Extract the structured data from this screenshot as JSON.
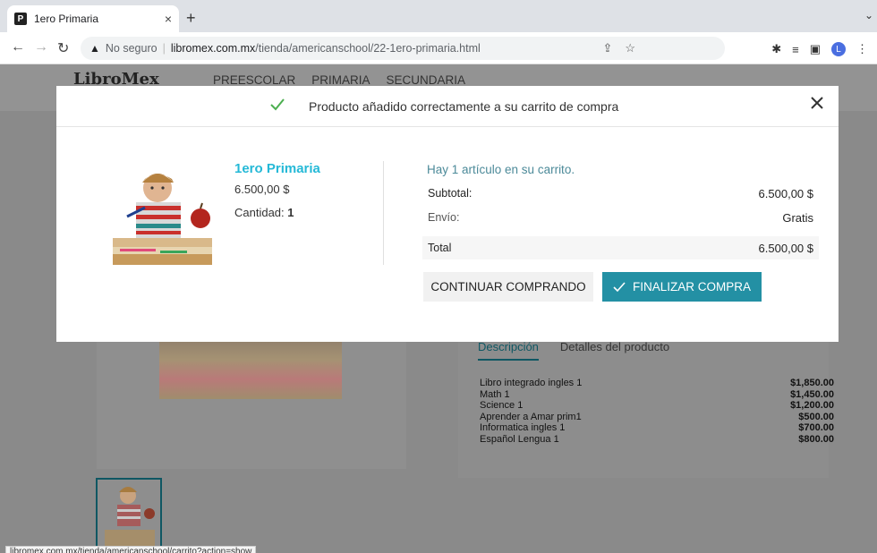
{
  "browser": {
    "tab_title": "1ero Primaria",
    "tab_favicon_letter": "P",
    "tab_close": "×",
    "new_tab": "+",
    "url_security": "No seguro",
    "url_host": "libromex.com.mx",
    "url_path": "/tienda/americanschool/22-1ero-primaria.html",
    "profile_initial": "L"
  },
  "site": {
    "logo": "LibroMex",
    "nav": [
      "PREESCOLAR",
      "PRIMARIA",
      "SECUNDARIA"
    ],
    "tabs": {
      "active": "Descripción",
      "other": "Detalles del producto"
    },
    "books": [
      {
        "name": "Libro integrado ingles 1",
        "price": "$1,850.00"
      },
      {
        "name": "Math 1",
        "price": "$1,450.00"
      },
      {
        "name": "Science 1",
        "price": "$1,200.00"
      },
      {
        "name": "Aprender a Amar prim1",
        "price": "$500.00"
      },
      {
        "name": "Informatica ingles 1",
        "price": "$700.00"
      },
      {
        "name": "Español Lengua 1",
        "price": "$800.00"
      }
    ],
    "status_url": "libromex.com.mx/tienda/americanschool/carrito?action=show"
  },
  "modal": {
    "title": "Producto añadido correctamente a su carrito de compra",
    "product_name": "1ero Primaria",
    "product_price": "6.500,00 $",
    "quantity_label": "Cantidad:",
    "quantity_value": "1",
    "cart_count_text": "Hay 1 artículo en su carrito.",
    "subtotal_label": "Subtotal:",
    "subtotal_value": "6.500,00 $",
    "shipping_label": "Envío:",
    "shipping_value": "Gratis",
    "total_label": "Total",
    "total_value": "6.500,00 $",
    "continue_button": "CONTINUAR COMPRANDO",
    "checkout_button": "FINALIZAR COMPRA"
  },
  "colors": {
    "accent": "#2390a4",
    "product_name": "#25b9d7",
    "check": "#4caf50"
  }
}
